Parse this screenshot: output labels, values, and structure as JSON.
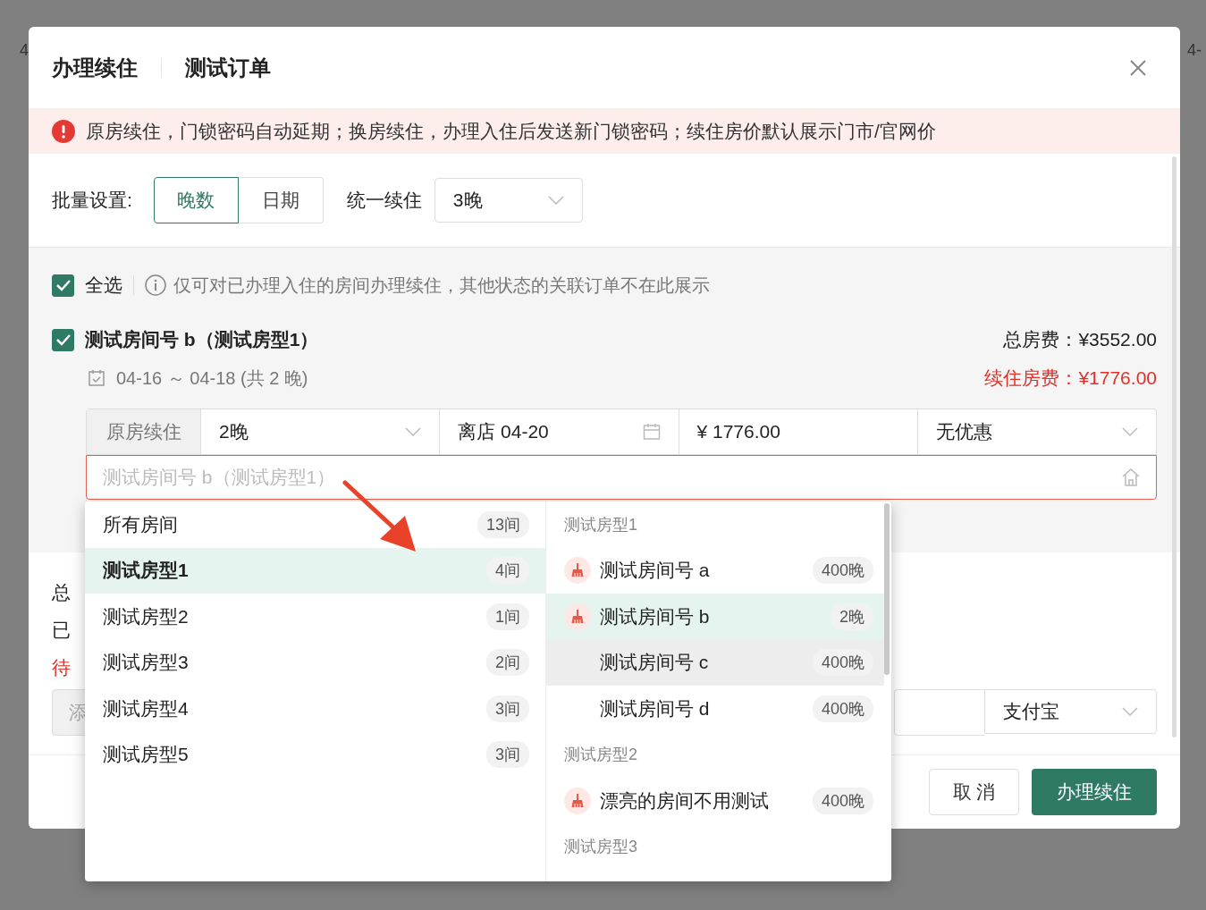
{
  "background": {
    "texts": [
      "4",
      "4-"
    ]
  },
  "modal": {
    "title": "办理续住",
    "subtitle": "测试订单"
  },
  "alert": {
    "text": "原房续住，门锁密码自动延期；换房续住，办理入住后发送新门锁密码；续住房价默认展示门市/官网价"
  },
  "batch": {
    "label": "批量设置:",
    "modes": [
      {
        "label": "晚数",
        "selected": true
      },
      {
        "label": "日期",
        "selected": false
      }
    ],
    "unify_label": "统一续住",
    "unify_value": "3晚"
  },
  "select_all": {
    "label": "全选",
    "checked": true,
    "note": "仅可对已办理入住的房间办理续住，其他状态的关联订单不在此展示"
  },
  "room": {
    "checked": true,
    "name": "测试房间号 b（测试房型1）",
    "dates": "04-16 ～ 04-18 (共 2 晚)",
    "total": "总房费：¥3552.00",
    "extend": "续住房费：¥1776.00",
    "mode": "原房续住",
    "nights": "2晚",
    "checkout": "离店 04-20",
    "price": "¥ 1776.00",
    "discount": "无优惠",
    "room_placeholder": "测试房间号 b（测试房型1）"
  },
  "summary": {
    "total": "总",
    "paid": "已",
    "due": "待",
    "add_button": "添",
    "payment": "支付宝"
  },
  "footer": {
    "cancel": "取 消",
    "confirm": "办理续住"
  },
  "dropdown": {
    "categories": [
      {
        "label": "所有房间",
        "count": "13间",
        "selected": false
      },
      {
        "label": "测试房型1",
        "count": "4间",
        "selected": true
      },
      {
        "label": "测试房型2",
        "count": "1间",
        "selected": false
      },
      {
        "label": "测试房型3",
        "count": "2间",
        "selected": false
      },
      {
        "label": "测试房型4",
        "count": "3间",
        "selected": false
      },
      {
        "label": "测试房型5",
        "count": "3间",
        "selected": false
      }
    ],
    "groups": [
      {
        "title": "测试房型1",
        "rooms": [
          {
            "name": "测试房间号 a",
            "count": "400晚",
            "cleaning": true,
            "selected": false,
            "hovered": false
          },
          {
            "name": "测试房间号 b",
            "count": "2晚",
            "cleaning": true,
            "selected": true,
            "hovered": false
          },
          {
            "name": "测试房间号 c",
            "count": "400晚",
            "cleaning": false,
            "selected": false,
            "hovered": true
          },
          {
            "name": "测试房间号 d",
            "count": "400晚",
            "cleaning": false,
            "selected": false,
            "hovered": false
          }
        ]
      },
      {
        "title": "测试房型2",
        "rooms": [
          {
            "name": "漂亮的房间不用测试",
            "count": "400晚",
            "cleaning": true,
            "selected": false,
            "hovered": false
          }
        ]
      },
      {
        "title": "测试房型3"
      }
    ]
  }
}
